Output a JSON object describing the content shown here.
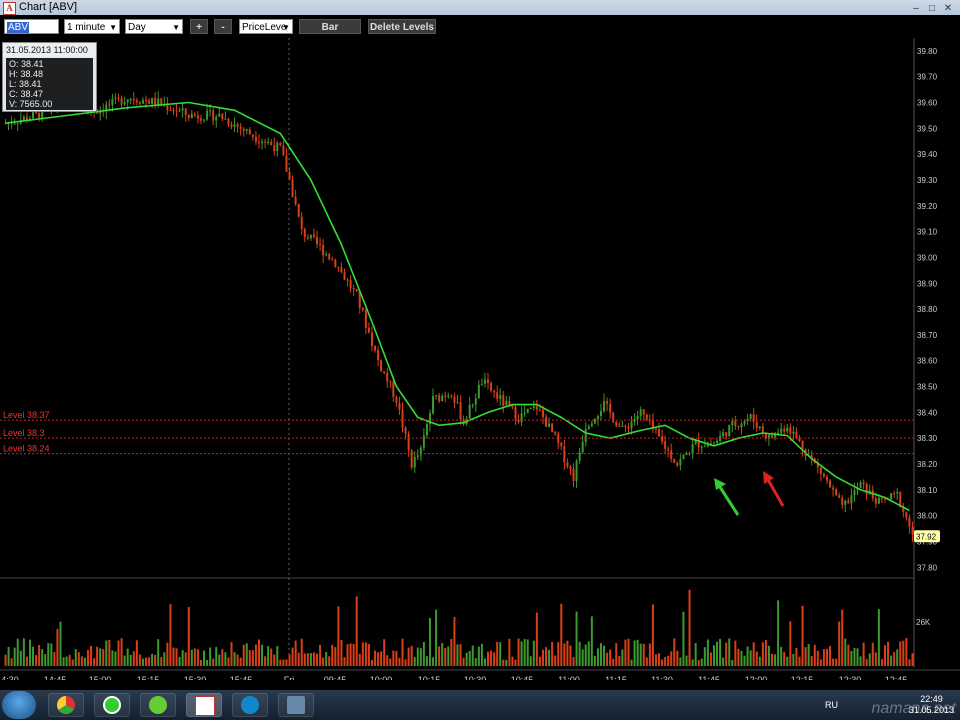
{
  "window": {
    "title": "Chart [ABV]",
    "minimize": "–",
    "maximize": "□",
    "close": "✕"
  },
  "toolbar": {
    "symbol": "ABV",
    "interval": "1 minute",
    "period": "Day",
    "zoom_in": "+",
    "zoom_out": "-",
    "price_level": "PriceLeve",
    "chart_type": "Bar",
    "delete_levels": "Delete Levels"
  },
  "info_box": {
    "datetime": "31.05.2013 11:00:00",
    "open": "O: 38.41",
    "high": "H: 38.48",
    "low": "L: 38.41",
    "close": "C: 38.47",
    "volume": "V: 7565.00"
  },
  "levels": [
    {
      "label": "Level 38.37",
      "price": 38.37
    },
    {
      "label": "Level 38.3",
      "price": 38.3
    },
    {
      "label": "Level 38.24",
      "price": 38.24
    }
  ],
  "last_price": "37.92",
  "volume_axis_label": "26K",
  "colors": {
    "up": "#3c9a2e",
    "down": "#d94018",
    "ma": "#33dd33",
    "level": "#cc2222",
    "green_arrow": "#33cc33",
    "red_arrow": "#dd2222"
  },
  "chart_data": {
    "type": "candlestick",
    "y_ticks": [
      39.8,
      39.7,
      39.6,
      39.5,
      39.4,
      39.3,
      39.2,
      39.1,
      39.0,
      38.9,
      38.8,
      38.7,
      38.6,
      38.5,
      38.4,
      38.3,
      38.2,
      38.1,
      38.0,
      37.9,
      37.8
    ],
    "y_tick_labels": [
      "39.80",
      "39.70",
      "39.60",
      "39.50",
      "39.40",
      "39.30",
      "39.20",
      "39.10",
      "39.00",
      "38.90",
      "38.80",
      "38.70",
      "38.60",
      "38.50",
      "38.40",
      "38.30",
      "38.20",
      "38.10",
      "38.00",
      "37.90",
      "37.80"
    ],
    "ylim": [
      37.77,
      39.85
    ],
    "x_labels": [
      "4:30",
      "14:45",
      "15:00",
      "15:15",
      "15:30",
      "15:45",
      "Fri",
      "09:45",
      "10:00",
      "10:15",
      "10:30",
      "10:45",
      "11:00",
      "11:15",
      "11:30",
      "11:45",
      "12:00",
      "12:15",
      "12:30",
      "12:45"
    ],
    "ma_points": [
      {
        "i": 0,
        "v": 39.52
      },
      {
        "i": 20,
        "v": 39.55
      },
      {
        "i": 40,
        "v": 39.58
      },
      {
        "i": 60,
        "v": 39.6
      },
      {
        "i": 75,
        "v": 39.57
      },
      {
        "i": 90,
        "v": 39.48
      },
      {
        "i": 100,
        "v": 39.3
      },
      {
        "i": 110,
        "v": 39.05
      },
      {
        "i": 120,
        "v": 38.75
      },
      {
        "i": 128,
        "v": 38.5
      },
      {
        "i": 135,
        "v": 38.38
      },
      {
        "i": 142,
        "v": 38.35
      },
      {
        "i": 150,
        "v": 38.36
      },
      {
        "i": 158,
        "v": 38.4
      },
      {
        "i": 166,
        "v": 38.43
      },
      {
        "i": 174,
        "v": 38.43
      },
      {
        "i": 182,
        "v": 38.38
      },
      {
        "i": 190,
        "v": 38.32
      },
      {
        "i": 198,
        "v": 38.3
      },
      {
        "i": 208,
        "v": 38.33
      },
      {
        "i": 216,
        "v": 38.35
      },
      {
        "i": 224,
        "v": 38.3
      },
      {
        "i": 232,
        "v": 38.27
      },
      {
        "i": 240,
        "v": 38.3
      },
      {
        "i": 248,
        "v": 38.32
      },
      {
        "i": 256,
        "v": 38.31
      },
      {
        "i": 264,
        "v": 38.22
      },
      {
        "i": 272,
        "v": 38.15
      },
      {
        "i": 280,
        "v": 38.1
      },
      {
        "i": 288,
        "v": 38.07
      },
      {
        "i": 296,
        "v": 38.02
      }
    ],
    "price_points": [
      {
        "i": 0,
        "v": 39.52
      },
      {
        "i": 10,
        "v": 39.55
      },
      {
        "i": 20,
        "v": 39.6
      },
      {
        "i": 30,
        "v": 39.57
      },
      {
        "i": 40,
        "v": 39.62
      },
      {
        "i": 50,
        "v": 39.6
      },
      {
        "i": 60,
        "v": 39.55
      },
      {
        "i": 70,
        "v": 39.55
      },
      {
        "i": 80,
        "v": 39.48
      },
      {
        "i": 90,
        "v": 39.42
      },
      {
        "i": 93,
        "v": 39.3
      },
      {
        "i": 97,
        "v": 39.1
      },
      {
        "i": 102,
        "v": 39.05
      },
      {
        "i": 108,
        "v": 38.98
      },
      {
        "i": 115,
        "v": 38.85
      },
      {
        "i": 122,
        "v": 38.6
      },
      {
        "i": 128,
        "v": 38.45
      },
      {
        "i": 133,
        "v": 38.2
      },
      {
        "i": 136,
        "v": 38.25
      },
      {
        "i": 140,
        "v": 38.45
      },
      {
        "i": 146,
        "v": 38.48
      },
      {
        "i": 150,
        "v": 38.36
      },
      {
        "i": 156,
        "v": 38.52
      },
      {
        "i": 162,
        "v": 38.45
      },
      {
        "i": 168,
        "v": 38.38
      },
      {
        "i": 174,
        "v": 38.42
      },
      {
        "i": 180,
        "v": 38.3
      },
      {
        "i": 186,
        "v": 38.15
      },
      {
        "i": 190,
        "v": 38.35
      },
      {
        "i": 196,
        "v": 38.43
      },
      {
        "i": 202,
        "v": 38.33
      },
      {
        "i": 208,
        "v": 38.4
      },
      {
        "i": 214,
        "v": 38.3
      },
      {
        "i": 220,
        "v": 38.2
      },
      {
        "i": 226,
        "v": 38.28
      },
      {
        "i": 232,
        "v": 38.28
      },
      {
        "i": 238,
        "v": 38.35
      },
      {
        "i": 244,
        "v": 38.38
      },
      {
        "i": 250,
        "v": 38.3
      },
      {
        "i": 256,
        "v": 38.35
      },
      {
        "i": 262,
        "v": 38.25
      },
      {
        "i": 268,
        "v": 38.15
      },
      {
        "i": 274,
        "v": 38.03
      },
      {
        "i": 280,
        "v": 38.12
      },
      {
        "i": 286,
        "v": 38.05
      },
      {
        "i": 292,
        "v": 38.08
      },
      {
        "i": 297,
        "v": 37.93
      }
    ],
    "bar_count": 298
  },
  "taskbar": {
    "language": "RU",
    "time": "22:49",
    "date": "31.05.2013"
  },
  "watermark": "namana.net"
}
